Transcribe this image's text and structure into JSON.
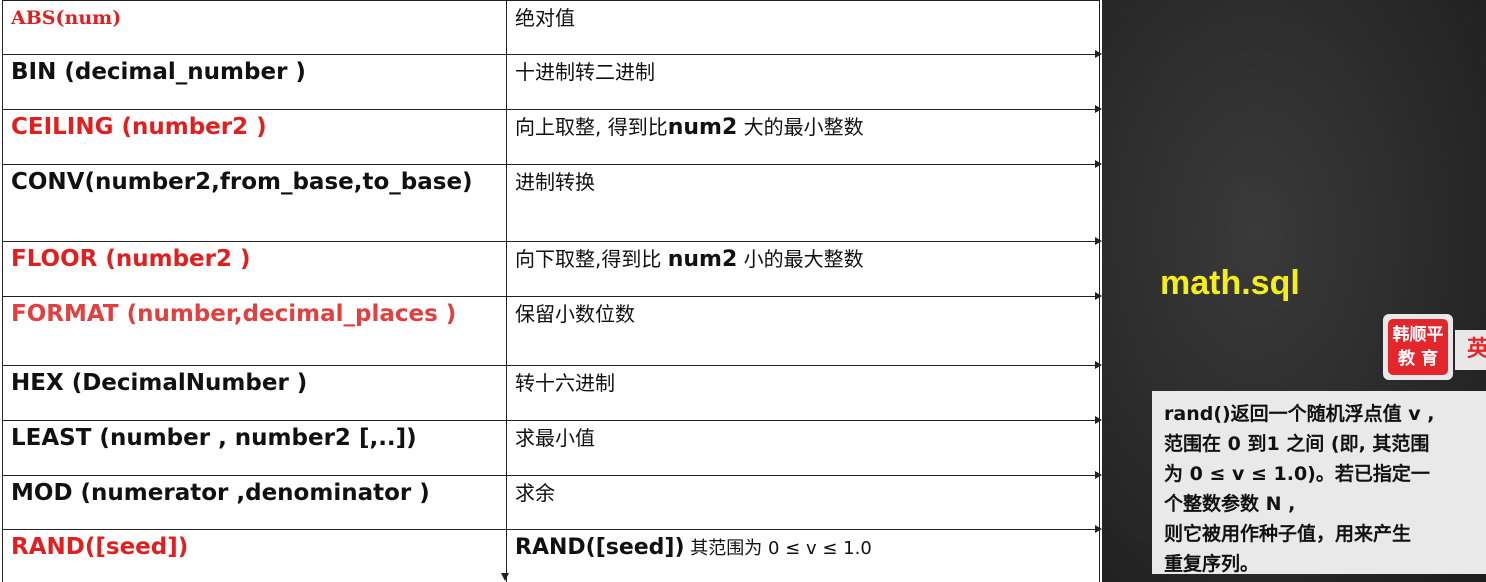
{
  "table": {
    "rows": [
      {
        "fn": "ABS(num)",
        "desc": "绝对值",
        "fn_color": "red"
      },
      {
        "fn": "BIN (decimal_number )",
        "desc": "十进制转二进制",
        "fn_color": "black"
      },
      {
        "fn": "CEILING (number2 )",
        "desc_pre": "向上取整, 得到比",
        "desc_bold": "num2",
        "desc_post": " 大的最小整数",
        "fn_color": "red"
      },
      {
        "fn": "CONV(number2,from_base,to_base)",
        "desc": "进制转换",
        "fn_color": "black"
      },
      {
        "fn": "FLOOR (number2 )",
        "desc_pre": "向下取整,得到比 ",
        "desc_bold": "num2",
        "desc_post": " 小的最大整数",
        "fn_color": "red"
      },
      {
        "fn": "FORMAT (number,decimal_places )",
        "desc": "保留小数位数",
        "fn_color": "red"
      },
      {
        "fn": "HEX (DecimalNumber )",
        "desc": "转十六进制",
        "fn_color": "black"
      },
      {
        "fn": "LEAST (number , number2  [,..])",
        "desc": "求最小值",
        "fn_color": "black"
      },
      {
        "fn": "MOD (numerator ,denominator )",
        "desc": "求余",
        "fn_color": "black"
      },
      {
        "fn": "RAND([seed])",
        "desc_bold": "RAND([seed])",
        "desc_post": " 其范围为 0 ≤ v ≤ 1.0",
        "fn_color": "red"
      }
    ]
  },
  "overlay": {
    "file_label": "math.sql",
    "logo_line1": "韩顺平",
    "logo_line2": "教 育",
    "logo_side": "英",
    "note": "rand()返回一个随机浮点值 v ,\n范围在 0 到1 之间 (即, 其范围\n为 0 ≤ v ≤ 1.0)。若已指定一\n个整数参数 N ,\n则它被用作种子值，用来产生\n重复序列。"
  },
  "colors": {
    "red": "#e02020",
    "label_yellow": "#f4ee1b",
    "board": "#2b2b2b",
    "note_bg": "#e9e9e9"
  }
}
